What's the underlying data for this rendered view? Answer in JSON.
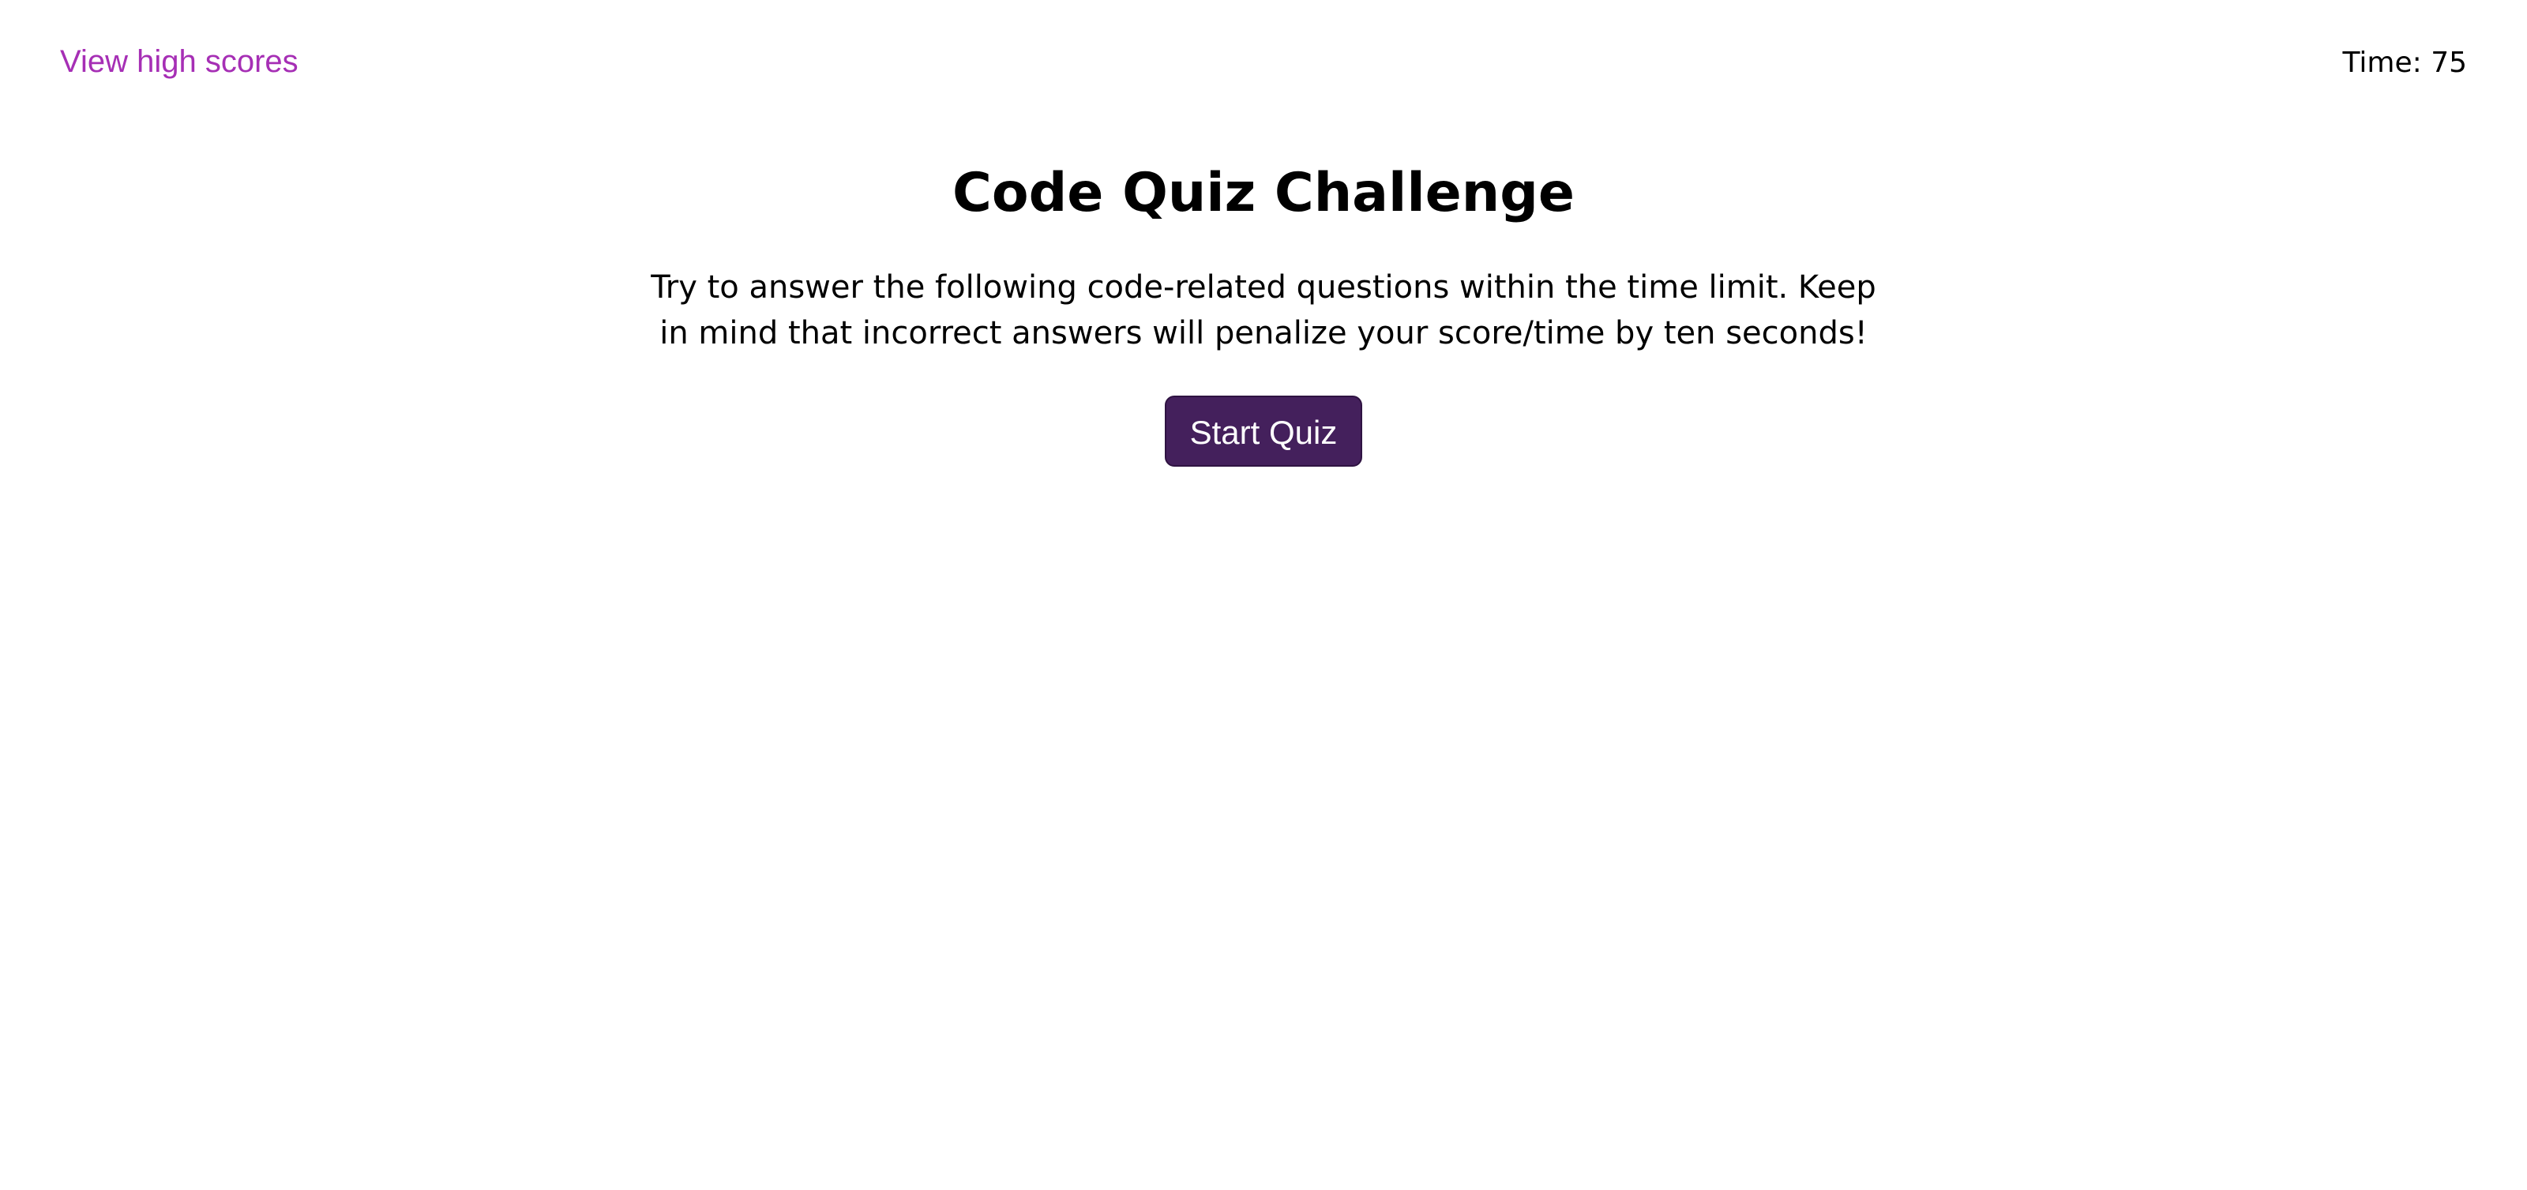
{
  "header": {
    "high_scores_label": "View high scores",
    "timer_text": "Time: 75"
  },
  "main": {
    "title": "Code Quiz Challenge",
    "description": "Try to answer the following code-related questions within the time limit. Keep in mind that incorrect answers will penalize your score/time by ten seconds!",
    "start_button_label": "Start Quiz"
  },
  "colors": {
    "link": "#a62fb5",
    "button_bg": "#44205c",
    "button_text": "#ffffff",
    "background": "#ffffff"
  }
}
